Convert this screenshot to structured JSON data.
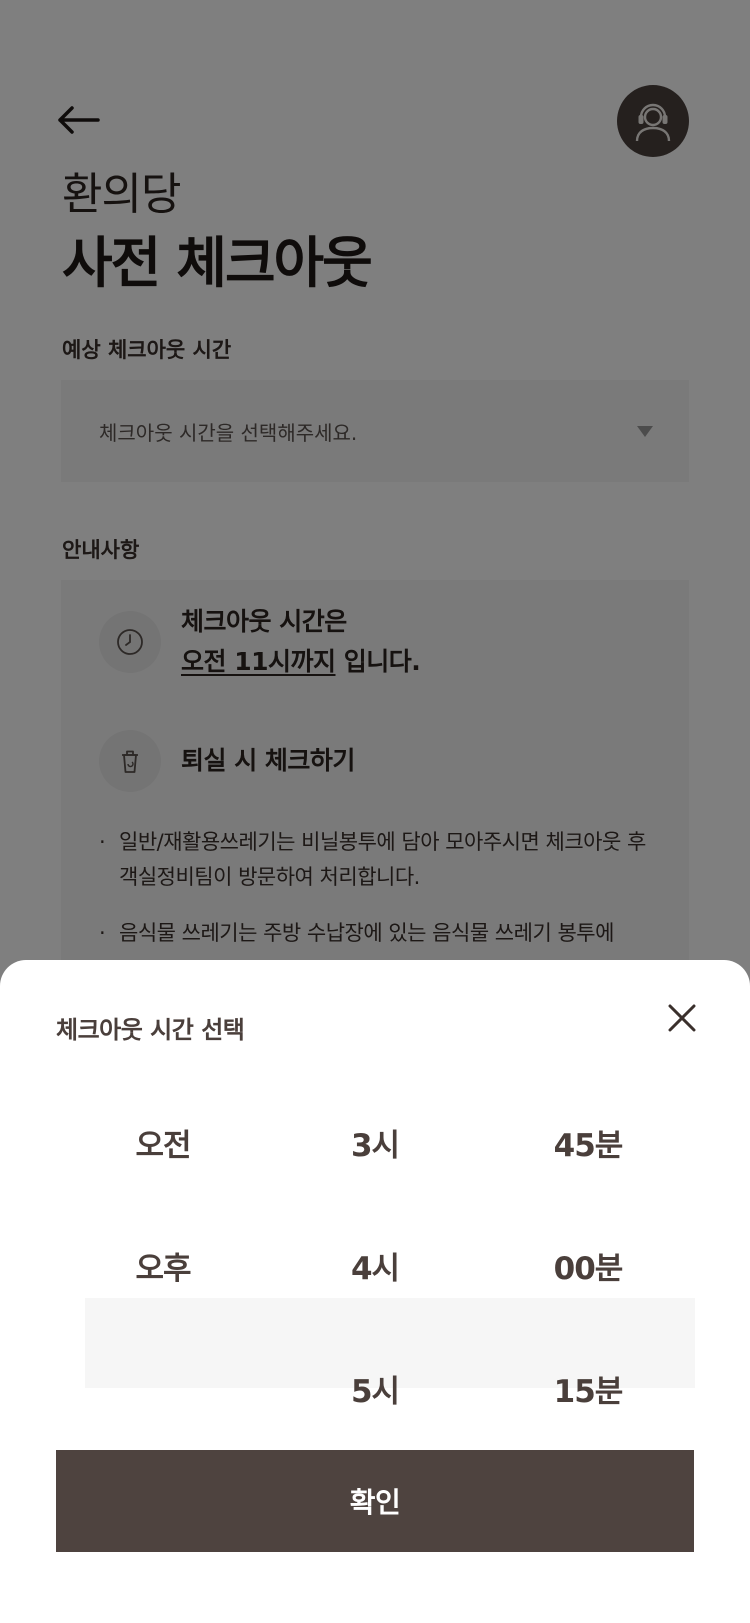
{
  "header": {
    "back_icon": "arrow-left-icon",
    "cs_icon": "headset-agent-icon",
    "hotel_name": "환의당",
    "title": "사전 체크아웃"
  },
  "checkout_time": {
    "label": "예상 체크아웃 시간",
    "placeholder": "체크아웃 시간을 선택해주세요."
  },
  "notice": {
    "label": "안내사항",
    "items": [
      {
        "icon": "clock-icon",
        "line1": "체크아웃 시간은",
        "line2_underlined": "오전 11시까지",
        "line2_rest": " 입니다."
      },
      {
        "icon": "trash-bin-icon",
        "text": "퇴실 시 체크하기"
      }
    ],
    "bullets": [
      "일반/재활용쓰레기는 비닐봉투에 담아 모아주시면 체크아웃 후 객실정비팀이 방문하여 처리합니다.",
      "음식물 쓰레기는 주방 수납장에 있는 음식물 쓰레기 봉투에"
    ]
  },
  "sheet": {
    "title": "체크아웃 시간 선택",
    "close_icon": "close-icon",
    "picker": {
      "ampm": [
        "오전",
        "오후",
        ""
      ],
      "hours": [
        "3시",
        "4시",
        "5시"
      ],
      "minutes": [
        "45분",
        "00분",
        "15분"
      ]
    },
    "confirm_label": "확인"
  },
  "colors": {
    "primary": "#4e433f",
    "text": "#3a302c",
    "field_bg": "#f4f4f4"
  }
}
